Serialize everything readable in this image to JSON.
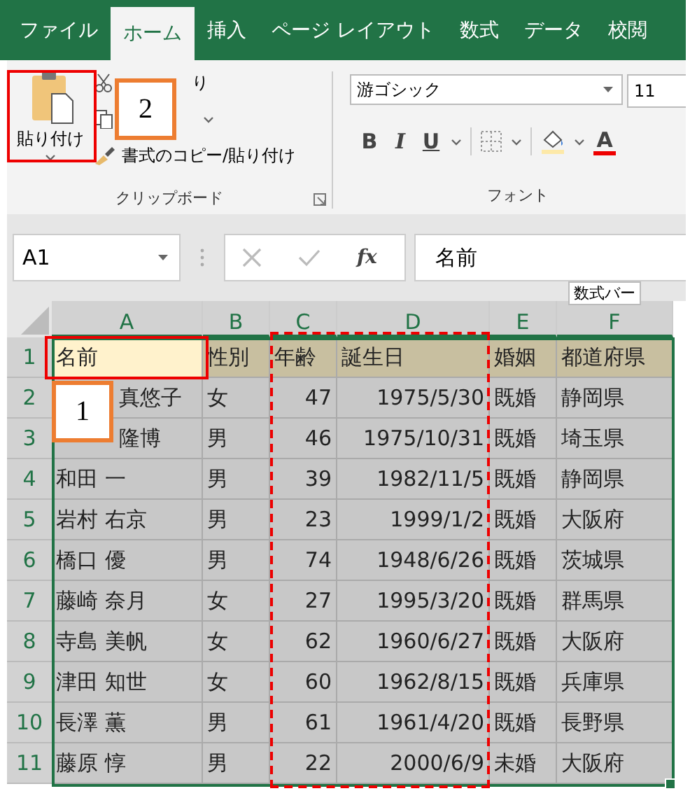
{
  "ribbon_tabs": [
    {
      "label": "ファイル",
      "selected": false
    },
    {
      "label": "ホーム",
      "selected": true
    },
    {
      "label": "挿入",
      "selected": false
    },
    {
      "label": "ページ レイアウト",
      "selected": false
    },
    {
      "label": "数式",
      "selected": false
    },
    {
      "label": "データ",
      "selected": false
    },
    {
      "label": "校閲",
      "selected": false
    }
  ],
  "clipboard": {
    "paste_label": "貼り付け",
    "cut_label": "り",
    "cut_covered": true,
    "format_painter_label": "書式のコピー/貼り付け",
    "group_label": "クリップボード"
  },
  "font": {
    "font_name": "游ゴシック",
    "font_size": "11",
    "bold": "B",
    "italic": "I",
    "underline": "U",
    "font_color": "A",
    "group_label": "フォント"
  },
  "formula_bar": {
    "name_box": "A1",
    "fx": "fx",
    "value": "名前",
    "tooltip": "数式バー"
  },
  "columns": [
    {
      "letter": "A",
      "kind": "text",
      "selected": true
    },
    {
      "letter": "B",
      "kind": "text",
      "selected": true
    },
    {
      "letter": "C",
      "kind": "number",
      "selected": true
    },
    {
      "letter": "D",
      "kind": "number",
      "selected": true
    },
    {
      "letter": "E",
      "kind": "text",
      "selected": true
    },
    {
      "letter": "F",
      "kind": "text",
      "selected": true
    }
  ],
  "rows": [
    {
      "number": "1",
      "kind": "header",
      "cells": [
        {
          "text": "名前",
          "selected": true,
          "covered": false
        },
        {
          "text": "性別",
          "selected": false
        },
        {
          "text": "年齢",
          "selected": false
        },
        {
          "text": "誕生日",
          "selected": false
        },
        {
          "text": "婚姻",
          "selected": false
        },
        {
          "text": "都道府県",
          "selected": false
        }
      ]
    },
    {
      "number": "2",
      "kind": "data",
      "cells": [
        {
          "text": "真悠子",
          "selected": false,
          "covered": true
        },
        {
          "text": "女",
          "selected": false
        },
        {
          "text": "47",
          "selected": false
        },
        {
          "text": "1975/5/30",
          "selected": false
        },
        {
          "text": "既婚",
          "selected": false
        },
        {
          "text": "静岡県",
          "selected": false
        }
      ]
    },
    {
      "number": "3",
      "kind": "data",
      "cells": [
        {
          "text": "隆博",
          "selected": false,
          "covered": true
        },
        {
          "text": "男",
          "selected": false
        },
        {
          "text": "46",
          "selected": false
        },
        {
          "text": "1975/10/31",
          "selected": false
        },
        {
          "text": "既婚",
          "selected": false
        },
        {
          "text": "埼玉県",
          "selected": false
        }
      ]
    },
    {
      "number": "4",
      "kind": "data",
      "cells": [
        {
          "text": "和田 一",
          "selected": false,
          "covered": false
        },
        {
          "text": "男",
          "selected": false
        },
        {
          "text": "39",
          "selected": false
        },
        {
          "text": "1982/11/5",
          "selected": false
        },
        {
          "text": "既婚",
          "selected": false
        },
        {
          "text": "静岡県",
          "selected": false
        }
      ]
    },
    {
      "number": "5",
      "kind": "data",
      "cells": [
        {
          "text": "岩村 右京",
          "selected": false,
          "covered": false
        },
        {
          "text": "男",
          "selected": false
        },
        {
          "text": "23",
          "selected": false
        },
        {
          "text": "1999/1/2",
          "selected": false
        },
        {
          "text": "既婚",
          "selected": false
        },
        {
          "text": "大阪府",
          "selected": false
        }
      ]
    },
    {
      "number": "6",
      "kind": "data",
      "cells": [
        {
          "text": "橋口 優",
          "selected": false,
          "covered": false
        },
        {
          "text": "男",
          "selected": false
        },
        {
          "text": "74",
          "selected": false
        },
        {
          "text": "1948/6/26",
          "selected": false
        },
        {
          "text": "既婚",
          "selected": false
        },
        {
          "text": "茨城県",
          "selected": false
        }
      ]
    },
    {
      "number": "7",
      "kind": "data",
      "cells": [
        {
          "text": "藤崎 奈月",
          "selected": false,
          "covered": false
        },
        {
          "text": "女",
          "selected": false
        },
        {
          "text": "27",
          "selected": false
        },
        {
          "text": "1995/3/20",
          "selected": false
        },
        {
          "text": "既婚",
          "selected": false
        },
        {
          "text": "群馬県",
          "selected": false
        }
      ]
    },
    {
      "number": "8",
      "kind": "data",
      "cells": [
        {
          "text": "寺島 美帆",
          "selected": false,
          "covered": false
        },
        {
          "text": "女",
          "selected": false
        },
        {
          "text": "62",
          "selected": false
        },
        {
          "text": "1960/6/27",
          "selected": false
        },
        {
          "text": "既婚",
          "selected": false
        },
        {
          "text": "大阪府",
          "selected": false
        }
      ]
    },
    {
      "number": "9",
      "kind": "data",
      "cells": [
        {
          "text": "津田 知世",
          "selected": false,
          "covered": false
        },
        {
          "text": "女",
          "selected": false
        },
        {
          "text": "60",
          "selected": false
        },
        {
          "text": "1962/8/15",
          "selected": false
        },
        {
          "text": "既婚",
          "selected": false
        },
        {
          "text": "兵庫県",
          "selected": false
        }
      ]
    },
    {
      "number": "10",
      "kind": "data",
      "cells": [
        {
          "text": "長澤 薫",
          "selected": false,
          "covered": false
        },
        {
          "text": "男",
          "selected": false
        },
        {
          "text": "61",
          "selected": false
        },
        {
          "text": "1961/4/20",
          "selected": false
        },
        {
          "text": "既婚",
          "selected": false
        },
        {
          "text": "長野県",
          "selected": false
        }
      ]
    },
    {
      "number": "11",
      "kind": "data",
      "cells": [
        {
          "text": "藤原 惇",
          "selected": false,
          "covered": false
        },
        {
          "text": "男",
          "selected": false
        },
        {
          "text": "22",
          "selected": false
        },
        {
          "text": "2000/6/9",
          "selected": false
        },
        {
          "text": "未婚",
          "selected": false
        },
        {
          "text": "大阪府",
          "selected": false
        }
      ]
    }
  ],
  "callouts": [
    {
      "label": "2"
    },
    {
      "label": "1"
    }
  ]
}
